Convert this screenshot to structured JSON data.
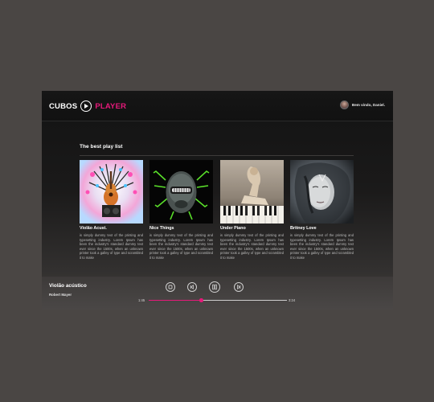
{
  "app": {
    "logo_left": "CUBOS",
    "logo_right": "PLAYER",
    "greeting": "Bem vindo, Daniel."
  },
  "playlist": {
    "title": "The best play list",
    "cards": [
      {
        "title": "Violão Acust.",
        "description": "is simply dummy text of the printing and typesetting industry. Lorem Ipsum has been the industry's standard dummy text ever since the 1500s, when an unknown printer took a galley of type and scrambled it to make"
      },
      {
        "title": "Nice Things",
        "description": "is simply dummy text of the printing and typesetting industry. Lorem Ipsum has been the industry's standard dummy text ever since the 1500s, when an unknown printer took a galley of type and scrambled it to make"
      },
      {
        "title": "Under Piano",
        "description": "is simply dummy text of the printing and typesetting industry. Lorem Ipsum has been the industry's standard dummy text ever since the 1500s, when an unknown printer took a galley of type and scrambled it to make"
      },
      {
        "title": "Britney Love",
        "description": "is simply dummy text of the printing and typesetting industry. Lorem Ipsum has been the industry's standard dummy text ever since the 1500s, when an unknown printer took a galley of type and scrambled it to make"
      }
    ]
  },
  "player": {
    "song_title": "Violão acústico",
    "artist": "Robert Mayer",
    "current_time": "1:45",
    "total_time": "3:24",
    "progress_fraction": 0.38,
    "controls": [
      "stop-icon",
      "previous-icon",
      "pause-icon",
      "next-icon"
    ]
  },
  "colors": {
    "accent": "#e6197a",
    "background": "#4a4644",
    "panel": "#141414"
  }
}
